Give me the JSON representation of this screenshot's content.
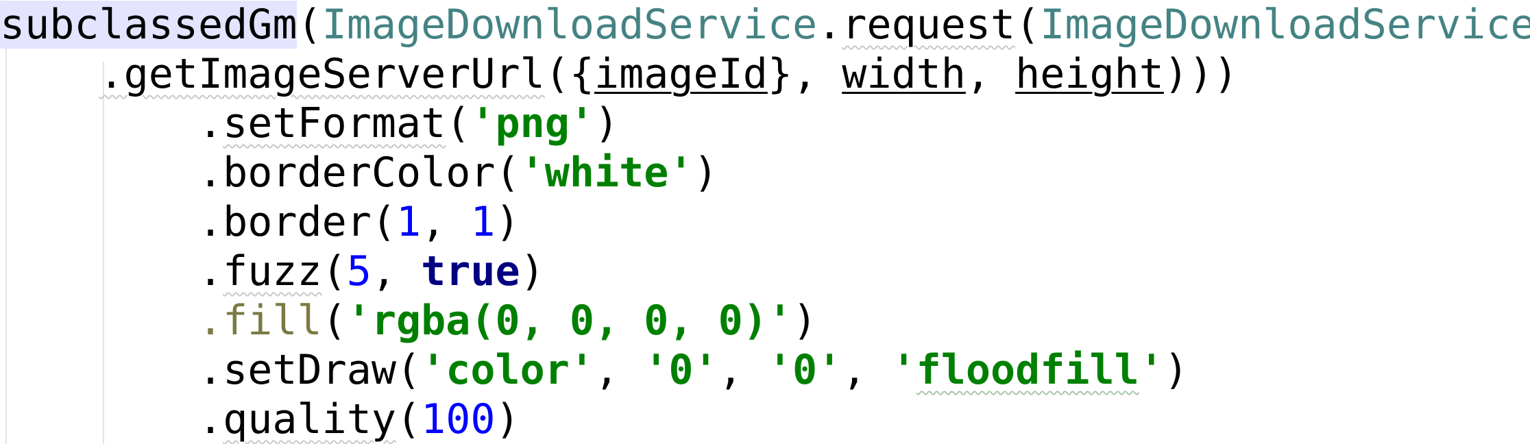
{
  "code": {
    "line1": {
      "fn": "subclassedGm",
      "p1": "(",
      "cls1": "ImageDownloadService",
      "dot": ".",
      "method": "request",
      "p2": "(",
      "cls2": "ImageDownloadService"
    },
    "line2": {
      "indent": "    ",
      "method": ".getImageServerUrl",
      "p1": "({",
      "arg1": "imageId",
      "p2": "}, ",
      "arg2": "width",
      "p3": ", ",
      "arg3": "height",
      "p4": ")))"
    },
    "line3": {
      "indent": "        ",
      "dot": ".",
      "method": "setFormat",
      "open": "(",
      "arg": "'png'",
      "close": ")"
    },
    "line4": {
      "indent": "        ",
      "method": ".borderColor",
      "open": "(",
      "arg": "'white'",
      "close": ")"
    },
    "line5": {
      "indent": "        ",
      "method": ".border",
      "open": "(",
      "arg1": "1",
      "sep": ", ",
      "arg2": "1",
      "close": ")"
    },
    "line6": {
      "indent": "        ",
      "dot": ".",
      "method": "fuzz",
      "open": "(",
      "arg1": "5",
      "sep": ", ",
      "arg2": "true",
      "close": ")"
    },
    "line7": {
      "indent": "        ",
      "method": ".fill",
      "open": "(",
      "arg": "'rgba(0, 0, 0, 0)'",
      "close": ")"
    },
    "line8": {
      "indent": "        ",
      "method": ".setDraw",
      "open": "(",
      "arg1": "'color'",
      "sep1": ", ",
      "arg2": "'0'",
      "sep2": ", ",
      "arg3": "'0'",
      "sep3": ", ",
      "arg4q": "'",
      "arg4": "floodfill",
      "arg4q2": "'",
      "close": ")"
    },
    "line9": {
      "indent": "        ",
      "dot": ".",
      "method": "quality",
      "open": "(",
      "arg": "100",
      "close": ")"
    }
  },
  "colors": {
    "background": "#ffffff",
    "class_name": "#458383",
    "keyword": "#000080",
    "number": "#0000ff",
    "string": "#008000",
    "identifier_highlight": "#e4e4ff",
    "deprecated_method": "#7a7a43"
  }
}
